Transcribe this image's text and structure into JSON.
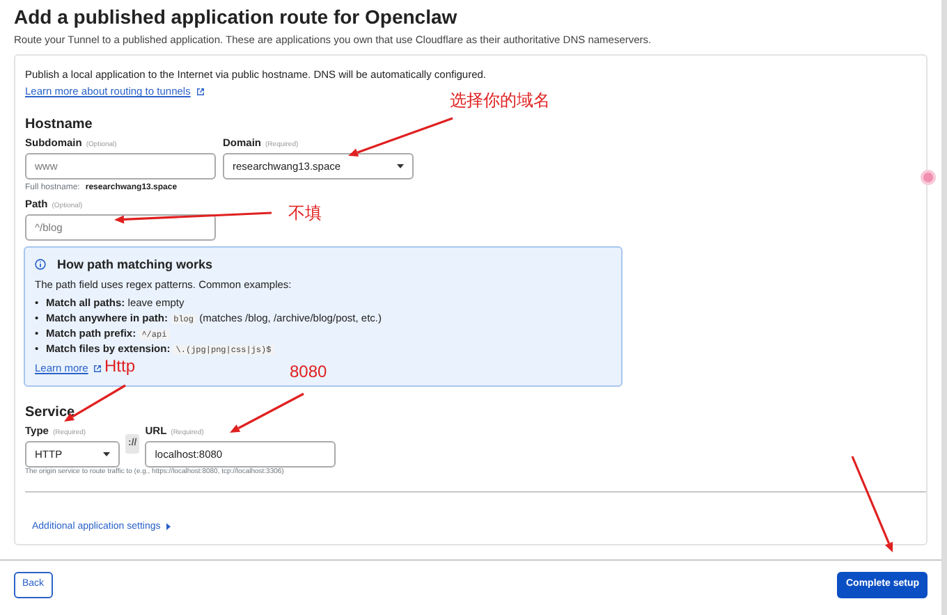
{
  "page": {
    "title": "Add a published application route for Openclaw",
    "subtitle": "Route your Tunnel to a published application. These are applications you own that use Cloudflare as their authoritative DNS nameservers."
  },
  "intro": {
    "text": "Publish a local application to the Internet via public hostname. DNS will be automatically configured.",
    "link": "Learn more about routing to tunnels"
  },
  "hostname": {
    "heading": "Hostname",
    "subdomain": {
      "label": "Subdomain",
      "hint": "(Optional)",
      "placeholder": "www"
    },
    "domain": {
      "label": "Domain",
      "hint": "(Required)",
      "value": "researchwang13.space"
    },
    "full_label": "Full hostname:",
    "full_value": "researchwang13.space",
    "path": {
      "label": "Path",
      "hint": "(Optional)",
      "placeholder": "^/blog"
    }
  },
  "info": {
    "title": "How path matching works",
    "intro": "The path field uses regex patterns. Common examples:",
    "items": [
      {
        "bullet": "•",
        "label": "Match all paths:",
        "text": "leave empty"
      },
      {
        "bullet": "•",
        "label": "Match anywhere in path:",
        "code": "blog",
        "text": "(matches /blog, /archive/blog/post, etc.)"
      },
      {
        "bullet": "•",
        "label": "Match path prefix:",
        "code": "^/api"
      },
      {
        "bullet": "•",
        "label": "Match files by extension:",
        "code": "\\.(jpg|png|css|js)$"
      }
    ],
    "link": "Learn more"
  },
  "service": {
    "heading": "Service",
    "type": {
      "label": "Type",
      "hint": "(Required)",
      "value": "HTTP"
    },
    "separator": "://",
    "url": {
      "label": "URL",
      "hint": "(Required)",
      "value": "localhost:8080"
    },
    "help": "The origin service to route traffic to (e.g., https://localhost:8080, tcp://localhost:3306)"
  },
  "additional": {
    "label": "Additional application settings",
    "expanded": false
  },
  "buttons": {
    "back": "Back",
    "complete": "Complete setup"
  },
  "annotations": [
    {
      "text": "选择你的域名"
    },
    {
      "text": "不填"
    },
    {
      "text": "Http"
    },
    {
      "text": "8080"
    }
  ]
}
